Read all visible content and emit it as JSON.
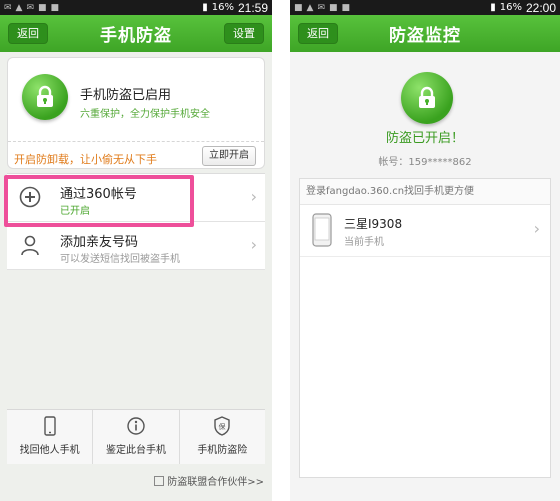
{
  "left": {
    "status_time": "21:59",
    "status_battery": "16%",
    "title": "手机防盗",
    "back_label": "返回",
    "settings_label": "设置",
    "card": {
      "title": "手机防盗已启用",
      "subtitle": "六重保护，全力保护手机安全",
      "warning": "开启防卸载，让小偷无从下手",
      "enable_button": "立即开启"
    },
    "items": [
      {
        "label": "通过360帐号",
        "sub": "已开启"
      },
      {
        "label": "添加亲友号码",
        "sub": "可以发送短信找回被盗手机"
      }
    ],
    "bottom": [
      {
        "label": "找回他人手机"
      },
      {
        "label": "鉴定此台手机"
      },
      {
        "label": "手机防盗险"
      }
    ],
    "footer": "防盗联盟合作伙伴>>"
  },
  "right": {
    "status_time": "22:00",
    "status_battery": "16%",
    "title": "防盗监控",
    "back_label": "返回",
    "status_title": "防盗已开启！",
    "account_label": "帐号：",
    "account_value": "159*****862",
    "login_hint": "登录fangdao.360.cn找回手机更方便",
    "device": {
      "name": "三星I9308",
      "sub": "当前手机"
    }
  },
  "colors": {
    "green": "#46b02a",
    "orange": "#e07b1a",
    "highlight": "#ee4f9a"
  }
}
